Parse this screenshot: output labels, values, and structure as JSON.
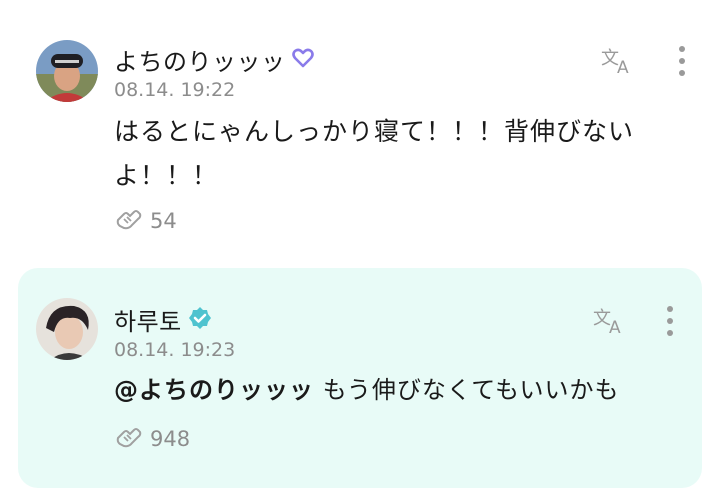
{
  "posts": [
    {
      "author": "よちのりッッッ",
      "timestamp": "08.14. 19:22",
      "body": "はるとにゃんしっかり寝て！！！背伸びないよ！！！",
      "reaction_count": "54",
      "badge_icon": "heart-outline-icon",
      "badge_color": "#8a7bea"
    },
    {
      "author": "하루토",
      "timestamp": "08.14. 19:23",
      "mention": "@よちのりッッッ",
      "body": " もう伸びなくてもいいかも",
      "reaction_count": "948",
      "badge_icon": "verified-check-icon",
      "badge_color": "#4fc3cf"
    }
  ],
  "icons": {
    "translate": "translate-icon",
    "more": "more-vertical-icon",
    "reaction": "reaction-icon"
  },
  "colors": {
    "highlight_background": "#e8fbf7",
    "muted_text": "#8c8c8c"
  }
}
